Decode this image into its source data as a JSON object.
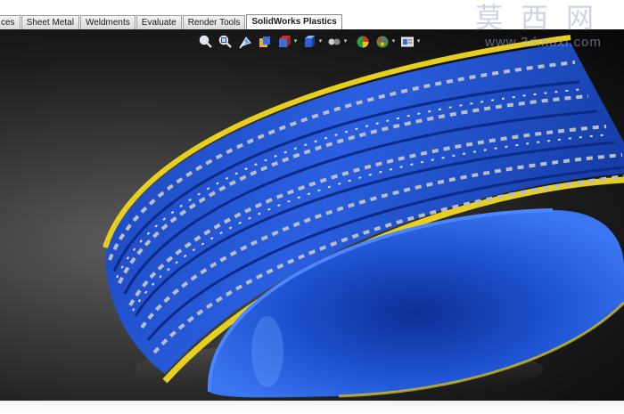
{
  "tabs": [
    {
      "label": "ces",
      "active": false
    },
    {
      "label": "Sheet Metal",
      "active": false
    },
    {
      "label": "Weldments",
      "active": false
    },
    {
      "label": "Evaluate",
      "active": false
    },
    {
      "label": "Render Tools",
      "active": false
    },
    {
      "label": "SolidWorks Plastics",
      "active": true
    }
  ],
  "heads_up_toolbar": [
    {
      "icon": "zoom-to-fit-icon",
      "dropdown": false
    },
    {
      "icon": "zoom-to-area-icon",
      "dropdown": false
    },
    {
      "icon": "previous-view-icon",
      "dropdown": false
    },
    {
      "icon": "section-view-icon",
      "dropdown": false
    },
    {
      "icon": "view-orientation-icon",
      "dropdown": true
    },
    {
      "icon": "display-style-icon",
      "dropdown": true
    },
    {
      "icon": "hide-show-items-icon",
      "dropdown": true
    },
    {
      "icon": "edit-appearance-icon",
      "dropdown": false
    },
    {
      "icon": "apply-scene-icon",
      "dropdown": true
    },
    {
      "icon": "view-settings-icon",
      "dropdown": true
    }
  ],
  "watermark": {
    "chinese": "莫西网",
    "url": "www.3dmoxi.com"
  },
  "model": {
    "name": "tire",
    "body_color": "#1f4fc8",
    "stripe_color": "#e6cf1e",
    "tread_color": "#b9bdc7"
  },
  "colors": {
    "viewport_center": "#5d5d5d",
    "viewport_edge": "#080808",
    "tab_active": "#ffffff"
  }
}
